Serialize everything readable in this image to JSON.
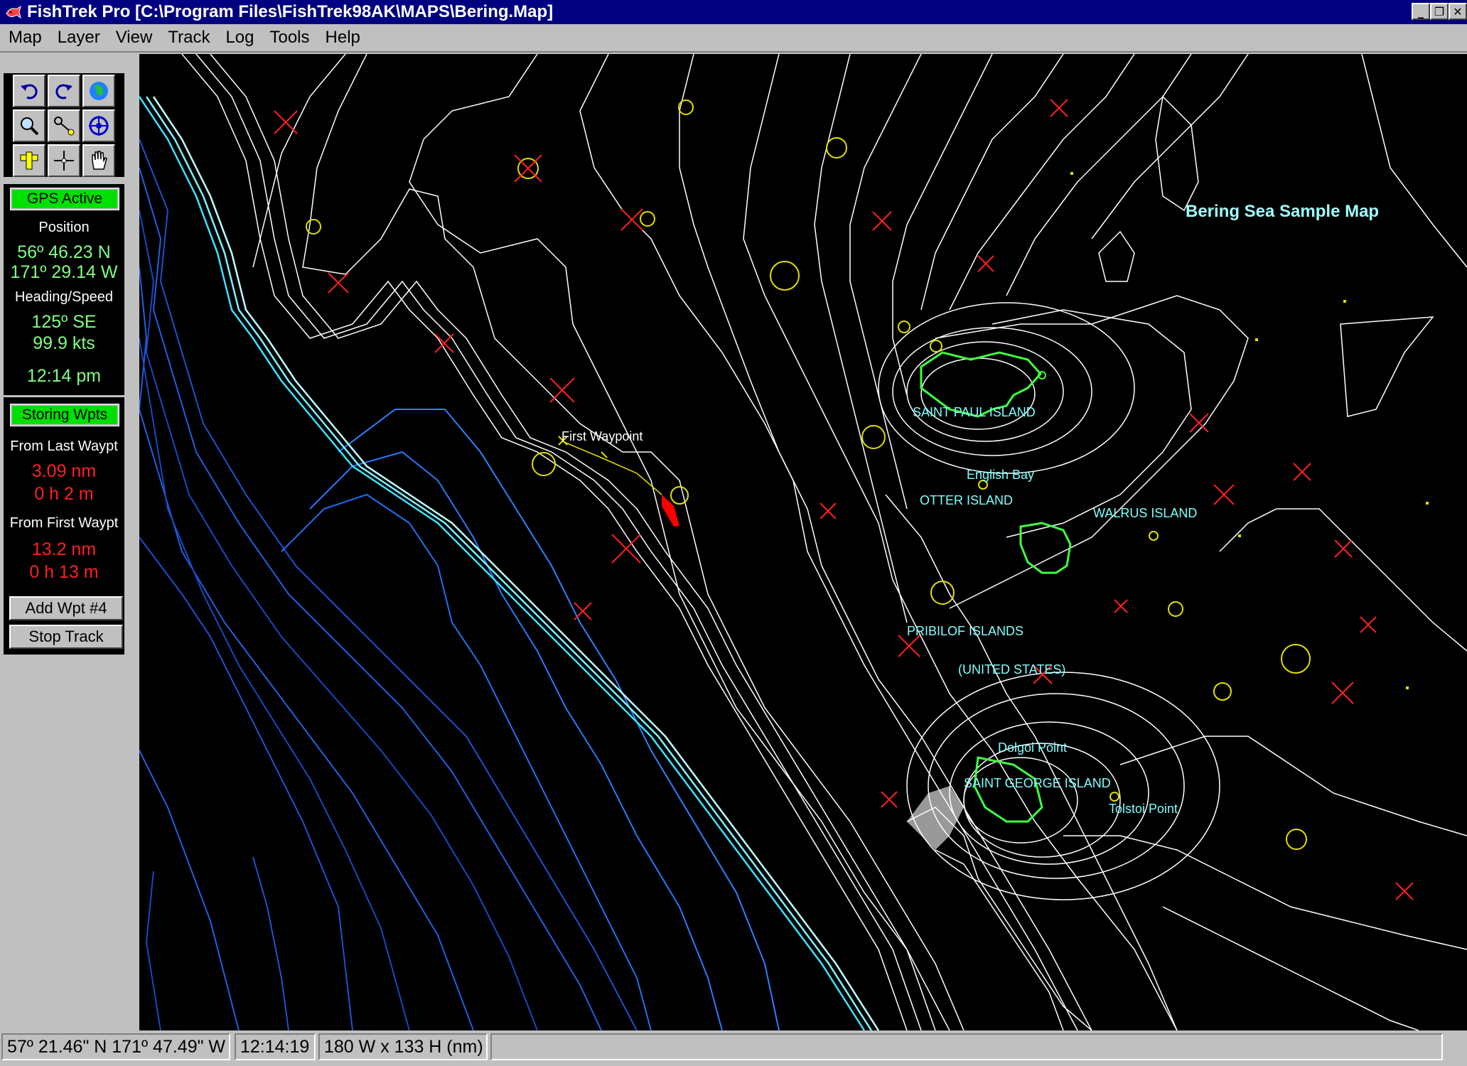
{
  "window": {
    "title": "FishTrek Pro [C:\\Program Files\\FishTrek98AK\\MAPS\\Bering.Map]",
    "minimize": "_",
    "restore": "❐",
    "close": "✕"
  },
  "menu": {
    "items": [
      "Map",
      "Layer",
      "View",
      "Track",
      "Log",
      "Tools",
      "Help"
    ]
  },
  "toolbar": {
    "tools": [
      "undo-icon",
      "redo-icon",
      "globe-icon",
      "zoom-icon",
      "measure-icon",
      "center-icon",
      "ruler-icon",
      "crosshair-icon",
      "pan-hand-icon"
    ]
  },
  "gps": {
    "status": "GPS Active",
    "position_label": "Position",
    "lat": "56º 46.23 N",
    "lon": "171º 29.14 W",
    "heading_label": "Heading/Speed",
    "heading": "125º  SE",
    "speed": "99.9 kts",
    "time": "12:14 pm"
  },
  "waypoints": {
    "status": "Storing Wpts",
    "from_last_label": "From Last Waypt",
    "from_last_dist": "3.09 nm",
    "from_last_time": "0 h 2 m",
    "from_first_label": "From First Waypt",
    "from_first_dist": "13.2 nm",
    "from_first_time": "0 h 13 m",
    "add_button": "Add Wpt #4",
    "stop_button": "Stop Track"
  },
  "map": {
    "title": "Bering Sea Sample Map",
    "labels": {
      "first_waypoint": "First Waypoint",
      "saint_paul": "SAINT PAUL ISLAND",
      "english_bay": "English Bay",
      "otter_island": "OTTER ISLAND",
      "walrus_island": "WALRUS ISLAND",
      "pribilof": "PRIBILOF ISLANDS",
      "united_states": "(UNITED STATES)",
      "dolgoi_point": "Dolgoi Point",
      "saint_george": "SAINT GEORGE ISLAND",
      "tolstoi_point": "Tolstoi Point"
    },
    "colors": {
      "background": "#000000",
      "contour": "#ffffff",
      "shelf_cyan": "#40e0ff",
      "deep_blue": "#2060e0",
      "marker_red": "#ff2020",
      "marker_yellow": "#e0e000",
      "island_green": "#40ff40",
      "vessel": "#ff0000"
    }
  },
  "statusbar": {
    "cursor_position": "57º 21.46\" N 171º 47.49\" W",
    "time": "12:14:19",
    "extent": "180 W x 133 H (nm)"
  }
}
